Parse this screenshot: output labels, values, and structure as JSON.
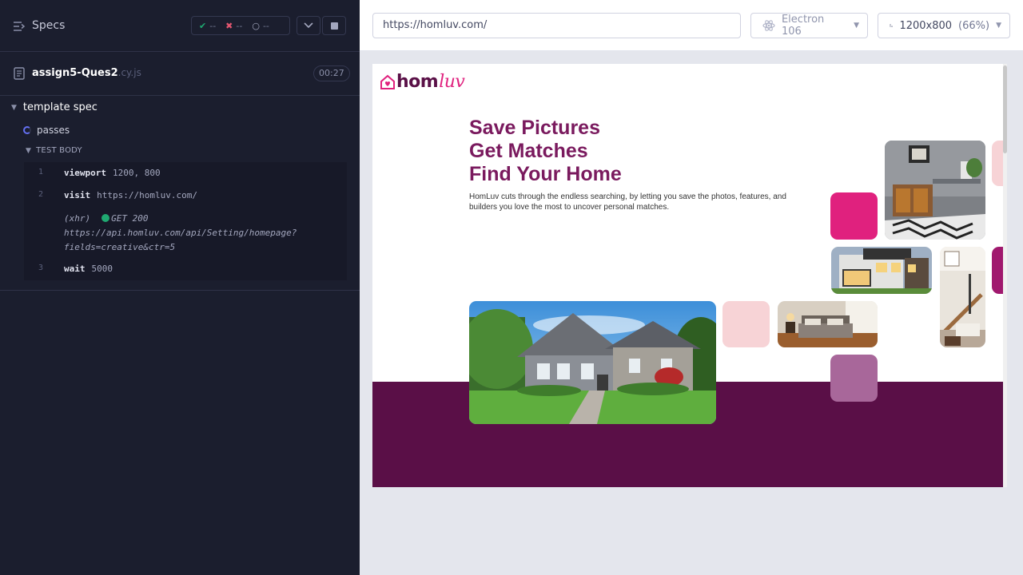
{
  "reporter": {
    "header": {
      "specs_label": "Specs",
      "passed_count": "--",
      "failed_count": "--",
      "pending_count": "--"
    },
    "file": {
      "name": "assign5-Ques2",
      "ext": ".cy.js",
      "duration": "00:27"
    },
    "suite": {
      "title": "template spec",
      "test_title": "passes",
      "body_label": "TEST BODY"
    },
    "commands": [
      {
        "num": "1",
        "name": "viewport",
        "arg": "1200, 800"
      },
      {
        "num": "2",
        "name": "visit",
        "arg": "https://homluv.com/"
      },
      {
        "num": "3",
        "name": "wait",
        "arg": "5000"
      }
    ],
    "xhr": {
      "tag": "(xhr)",
      "status": "GET 200",
      "url_line1": "https://api.homluv.com/api/Setting/homepage?",
      "url_line2": "fields=creative&ctr=5"
    }
  },
  "aut": {
    "url": "https://homluv.com/",
    "browser": "Electron 106",
    "viewport": "1200x800",
    "scale": "(66%)"
  },
  "site": {
    "logo_home": "hom",
    "logo_luv": "luv",
    "hero_lines": [
      "Save Pictures",
      "Get Matches",
      "Find Your Home"
    ],
    "hero_sub": "HomLuv cuts through the endless searching, by letting you save the photos, features, and builders you love the most to uncover personal matches."
  },
  "colors": {
    "brand_purple": "#7a1a5e",
    "band_purple": "#5a0f47",
    "magenta": "#e0217e",
    "pink": "#f7d3d6",
    "mauve": "#a8679a",
    "pass_green": "#1fa971",
    "fail_red": "#e45770"
  }
}
